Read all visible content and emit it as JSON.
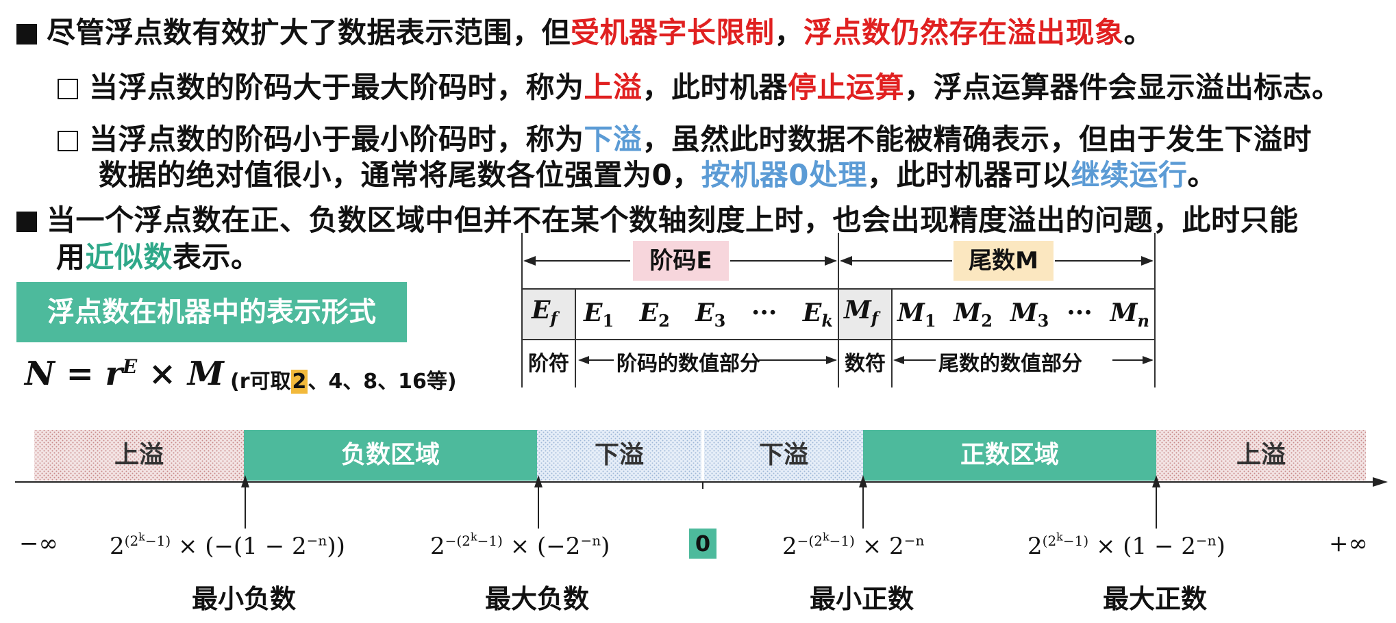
{
  "bullet1": {
    "part1": "尽管浮点数有效扩大了数据表示范围，但",
    "red1": "受机器字长限制",
    "comma": "，",
    "red2": "浮点数仍然存在溢出现象",
    "end": "。"
  },
  "sub1": {
    "part1": "当浮点数的阶码大于最大阶码时，称为",
    "red1": "上溢",
    "part2": "，此时机器",
    "red2": "停止运算",
    "part3": "，浮点运算器件会显示溢出标志。"
  },
  "sub2": {
    "part1": "当浮点数的阶码小于最小阶码时，称为",
    "blue1": "下溢",
    "part2": "，虽然此时数据不能被精确表示，但由于发生下溢时",
    "line2_part1": "数据的绝对值很小，通常将尾数各位强置为0，",
    "blue2": "按机器0处理",
    "line2_part2": "，此时机器可以",
    "blue3": "继续运行",
    "line2_end": "。"
  },
  "bullet2": {
    "line1": "当一个浮点数在正、负数区域中但并不在某个数轴刻度上时，也会出现精度溢出的问题，此时只能",
    "line2_pre": "用",
    "teal": "近似数",
    "line2_post": "表示。"
  },
  "format_box": "浮点数在机器中的表示形式",
  "formula": {
    "main": "N = r",
    "sup": "E",
    "rest": " × M",
    "note_pre": "(r可取",
    "note_hl": "2",
    "note_post": "、4、8、16等)"
  },
  "layout_diagram": {
    "exp_label": "阶码E",
    "man_label": "尾数M",
    "cells": {
      "ef": "E",
      "ef_sub": "f",
      "e_seq": [
        "E",
        "E",
        "E",
        "···",
        "E"
      ],
      "e_subs": [
        "1",
        "2",
        "3",
        "",
        "k"
      ],
      "mf": "M",
      "mf_sub": "f",
      "m_seq": [
        "M",
        "M",
        "M",
        "···",
        "M"
      ],
      "m_subs": [
        "1",
        "2",
        "3",
        "",
        "n"
      ]
    },
    "desc": {
      "exp_sign": "阶符",
      "exp_value": "阶码的数值部分",
      "man_sign": "数符",
      "man_value": "尾数的数值部分"
    }
  },
  "number_line": {
    "regions": [
      "上溢",
      "负数区域",
      "下溢",
      "下溢",
      "正数区域",
      "上溢"
    ],
    "neg_inf": "−∞",
    "pos_inf": "+∞",
    "zero": "0",
    "labels": {
      "min_neg": "2^(2^k−1) × (−(1 − 2^−n))",
      "max_neg": "2^−(2^k−1) × (−2^−n)",
      "min_pos": "2^−(2^k−1) × 2^−n",
      "max_pos": "2^(2^k−1) × (1 − 2^−n)"
    },
    "bottom": [
      "最小负数",
      "最大负数",
      "最小正数",
      "最大正数"
    ]
  },
  "colors": {
    "red": "#e02020",
    "blue": "#5b9bd5",
    "teal": "#4dba9c",
    "pink": "#f7d6dc",
    "cream": "#fbe7c0",
    "highlight": "#f2b93b"
  }
}
